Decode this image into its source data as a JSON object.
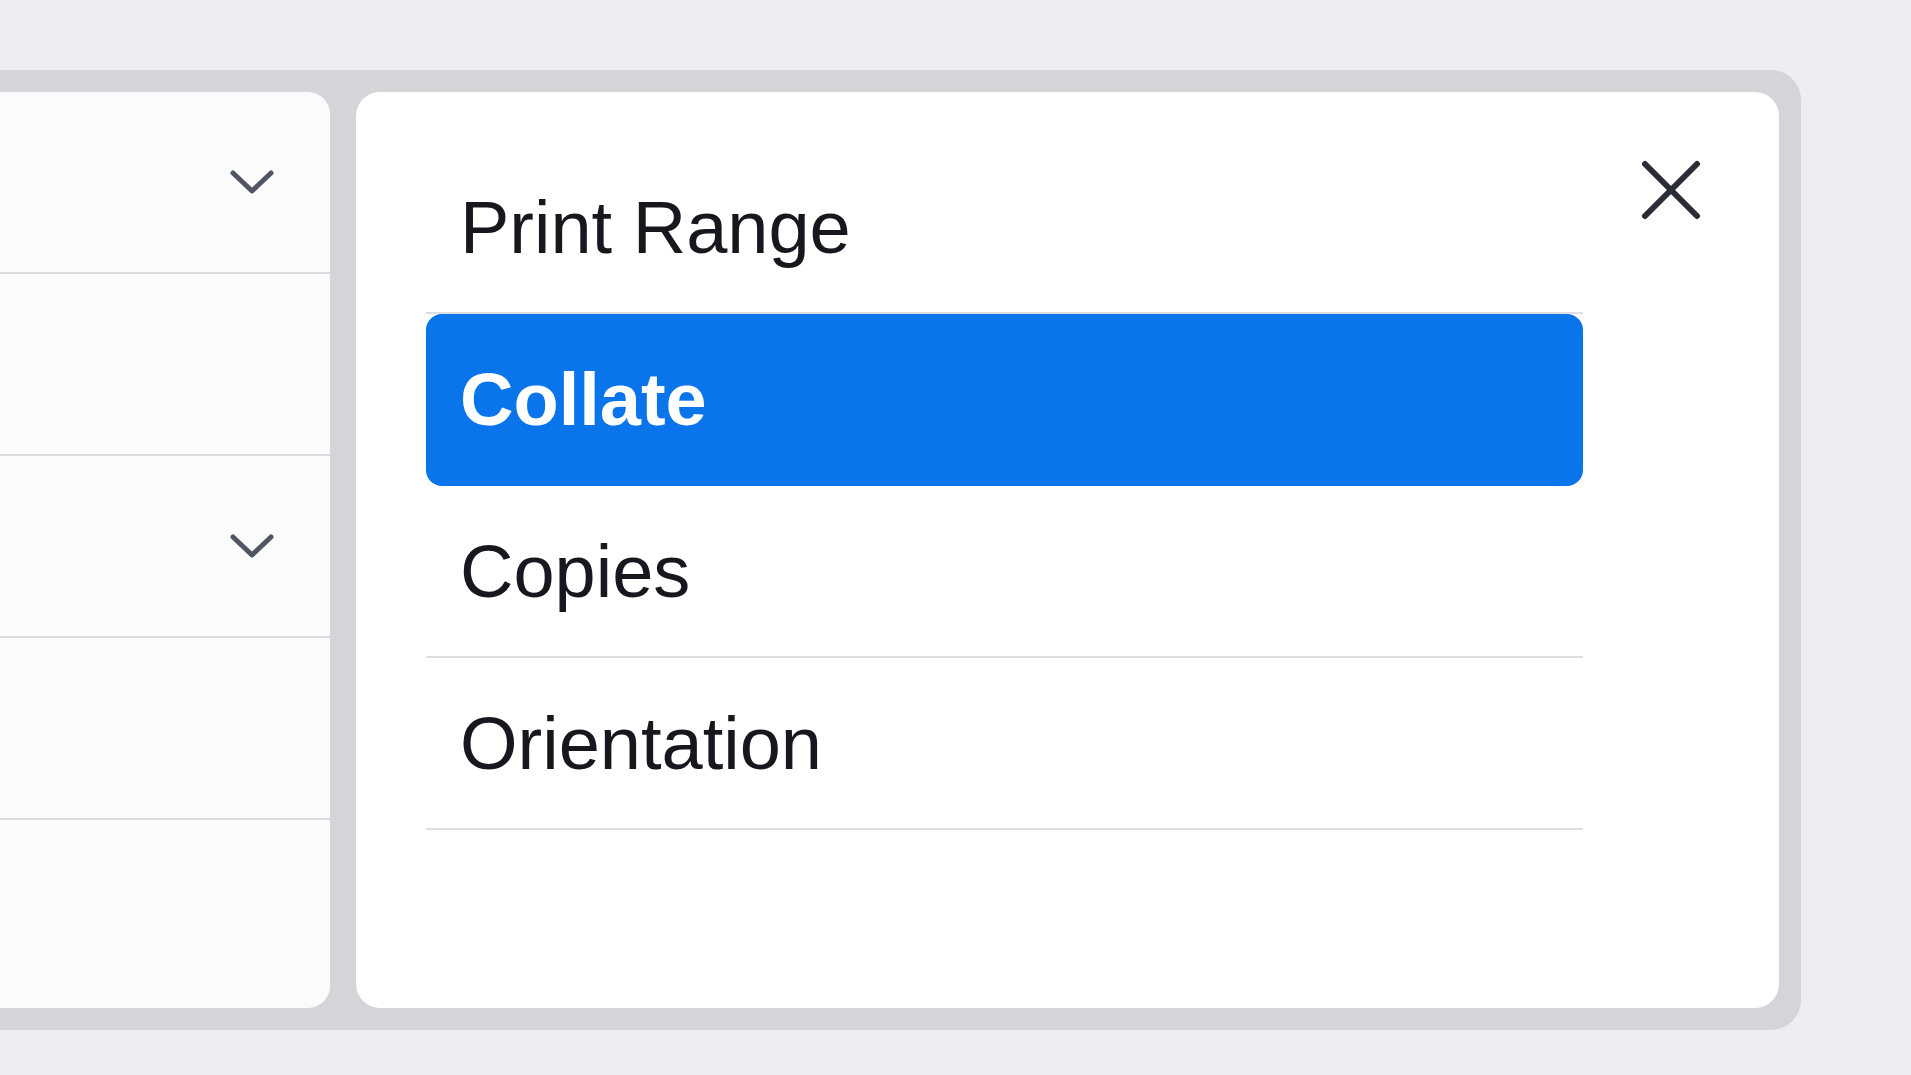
{
  "side_panel": {
    "rows": [
      {
        "kind": "dropdown"
      },
      {
        "kind": "blank"
      },
      {
        "kind": "dropdown"
      },
      {
        "kind": "blank"
      }
    ]
  },
  "options": {
    "items": [
      {
        "label": "Print Range",
        "selected": false
      },
      {
        "label": "Collate",
        "selected": true
      },
      {
        "label": "Copies",
        "selected": false
      },
      {
        "label": "Orientation",
        "selected": false
      }
    ]
  }
}
